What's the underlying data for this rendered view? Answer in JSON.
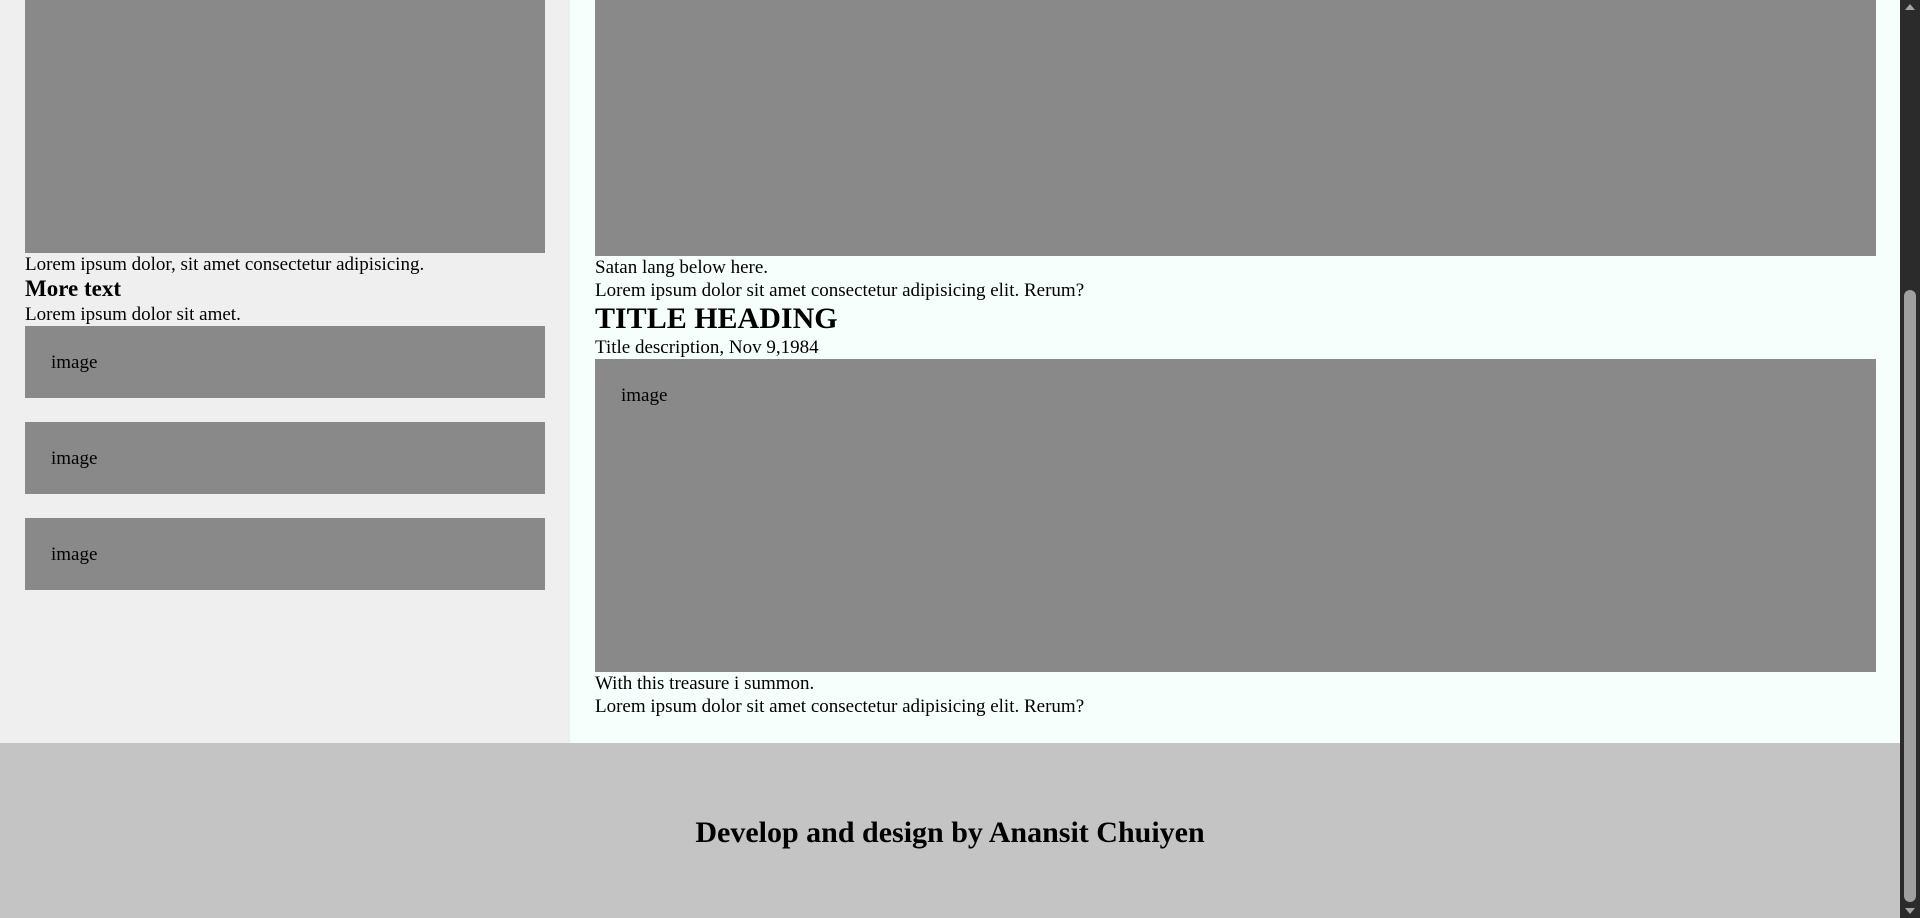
{
  "sidebar": {
    "hero_caption": "Lorem ipsum dolor, sit amet consectetur adipisicing.",
    "more_title": "More text",
    "more_text": "Lorem ipsum dolor sit amet.",
    "images": [
      {
        "label": "image"
      },
      {
        "label": "image"
      },
      {
        "label": "image"
      }
    ]
  },
  "main": {
    "post1": {
      "caption": "Satan lang below here.",
      "text": "Lorem ipsum dolor sit amet consectetur adipisicing elit. Rerum?"
    },
    "post2": {
      "title": "TITLE HEADING",
      "description": "Title description, Nov 9,1984",
      "image_label": "image",
      "caption": "With this treasure i summon.",
      "text": "Lorem ipsum dolor sit amet consectetur adipisicing elit. Rerum?"
    }
  },
  "footer": {
    "credit": "Develop and design by Anansit Chuiyen"
  },
  "colors": {
    "sidebar_bg": "#efefef",
    "main_bg": "#f7fffd",
    "image_placeholder": "#898989",
    "footer_bg": "#c4c4c4"
  }
}
